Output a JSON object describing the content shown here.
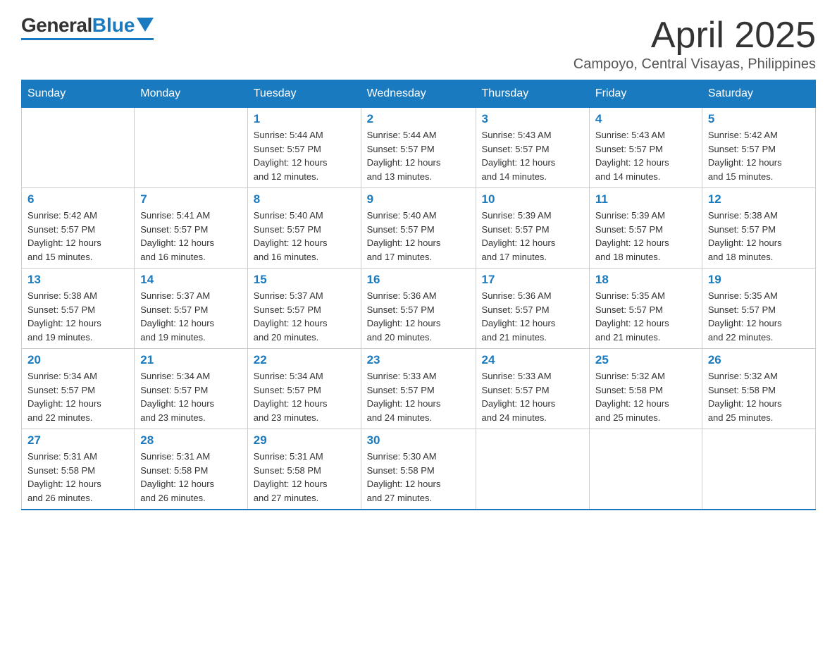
{
  "logo": {
    "general": "General",
    "blue": "Blue"
  },
  "title": {
    "month_year": "April 2025",
    "location": "Campoyo, Central Visayas, Philippines"
  },
  "headers": [
    "Sunday",
    "Monday",
    "Tuesday",
    "Wednesday",
    "Thursday",
    "Friday",
    "Saturday"
  ],
  "weeks": [
    [
      {
        "day": "",
        "info": ""
      },
      {
        "day": "",
        "info": ""
      },
      {
        "day": "1",
        "info": "Sunrise: 5:44 AM\nSunset: 5:57 PM\nDaylight: 12 hours\nand 12 minutes."
      },
      {
        "day": "2",
        "info": "Sunrise: 5:44 AM\nSunset: 5:57 PM\nDaylight: 12 hours\nand 13 minutes."
      },
      {
        "day": "3",
        "info": "Sunrise: 5:43 AM\nSunset: 5:57 PM\nDaylight: 12 hours\nand 14 minutes."
      },
      {
        "day": "4",
        "info": "Sunrise: 5:43 AM\nSunset: 5:57 PM\nDaylight: 12 hours\nand 14 minutes."
      },
      {
        "day": "5",
        "info": "Sunrise: 5:42 AM\nSunset: 5:57 PM\nDaylight: 12 hours\nand 15 minutes."
      }
    ],
    [
      {
        "day": "6",
        "info": "Sunrise: 5:42 AM\nSunset: 5:57 PM\nDaylight: 12 hours\nand 15 minutes."
      },
      {
        "day": "7",
        "info": "Sunrise: 5:41 AM\nSunset: 5:57 PM\nDaylight: 12 hours\nand 16 minutes."
      },
      {
        "day": "8",
        "info": "Sunrise: 5:40 AM\nSunset: 5:57 PM\nDaylight: 12 hours\nand 16 minutes."
      },
      {
        "day": "9",
        "info": "Sunrise: 5:40 AM\nSunset: 5:57 PM\nDaylight: 12 hours\nand 17 minutes."
      },
      {
        "day": "10",
        "info": "Sunrise: 5:39 AM\nSunset: 5:57 PM\nDaylight: 12 hours\nand 17 minutes."
      },
      {
        "day": "11",
        "info": "Sunrise: 5:39 AM\nSunset: 5:57 PM\nDaylight: 12 hours\nand 18 minutes."
      },
      {
        "day": "12",
        "info": "Sunrise: 5:38 AM\nSunset: 5:57 PM\nDaylight: 12 hours\nand 18 minutes."
      }
    ],
    [
      {
        "day": "13",
        "info": "Sunrise: 5:38 AM\nSunset: 5:57 PM\nDaylight: 12 hours\nand 19 minutes."
      },
      {
        "day": "14",
        "info": "Sunrise: 5:37 AM\nSunset: 5:57 PM\nDaylight: 12 hours\nand 19 minutes."
      },
      {
        "day": "15",
        "info": "Sunrise: 5:37 AM\nSunset: 5:57 PM\nDaylight: 12 hours\nand 20 minutes."
      },
      {
        "day": "16",
        "info": "Sunrise: 5:36 AM\nSunset: 5:57 PM\nDaylight: 12 hours\nand 20 minutes."
      },
      {
        "day": "17",
        "info": "Sunrise: 5:36 AM\nSunset: 5:57 PM\nDaylight: 12 hours\nand 21 minutes."
      },
      {
        "day": "18",
        "info": "Sunrise: 5:35 AM\nSunset: 5:57 PM\nDaylight: 12 hours\nand 21 minutes."
      },
      {
        "day": "19",
        "info": "Sunrise: 5:35 AM\nSunset: 5:57 PM\nDaylight: 12 hours\nand 22 minutes."
      }
    ],
    [
      {
        "day": "20",
        "info": "Sunrise: 5:34 AM\nSunset: 5:57 PM\nDaylight: 12 hours\nand 22 minutes."
      },
      {
        "day": "21",
        "info": "Sunrise: 5:34 AM\nSunset: 5:57 PM\nDaylight: 12 hours\nand 23 minutes."
      },
      {
        "day": "22",
        "info": "Sunrise: 5:34 AM\nSunset: 5:57 PM\nDaylight: 12 hours\nand 23 minutes."
      },
      {
        "day": "23",
        "info": "Sunrise: 5:33 AM\nSunset: 5:57 PM\nDaylight: 12 hours\nand 24 minutes."
      },
      {
        "day": "24",
        "info": "Sunrise: 5:33 AM\nSunset: 5:57 PM\nDaylight: 12 hours\nand 24 minutes."
      },
      {
        "day": "25",
        "info": "Sunrise: 5:32 AM\nSunset: 5:58 PM\nDaylight: 12 hours\nand 25 minutes."
      },
      {
        "day": "26",
        "info": "Sunrise: 5:32 AM\nSunset: 5:58 PM\nDaylight: 12 hours\nand 25 minutes."
      }
    ],
    [
      {
        "day": "27",
        "info": "Sunrise: 5:31 AM\nSunset: 5:58 PM\nDaylight: 12 hours\nand 26 minutes."
      },
      {
        "day": "28",
        "info": "Sunrise: 5:31 AM\nSunset: 5:58 PM\nDaylight: 12 hours\nand 26 minutes."
      },
      {
        "day": "29",
        "info": "Sunrise: 5:31 AM\nSunset: 5:58 PM\nDaylight: 12 hours\nand 27 minutes."
      },
      {
        "day": "30",
        "info": "Sunrise: 5:30 AM\nSunset: 5:58 PM\nDaylight: 12 hours\nand 27 minutes."
      },
      {
        "day": "",
        "info": ""
      },
      {
        "day": "",
        "info": ""
      },
      {
        "day": "",
        "info": ""
      }
    ]
  ]
}
